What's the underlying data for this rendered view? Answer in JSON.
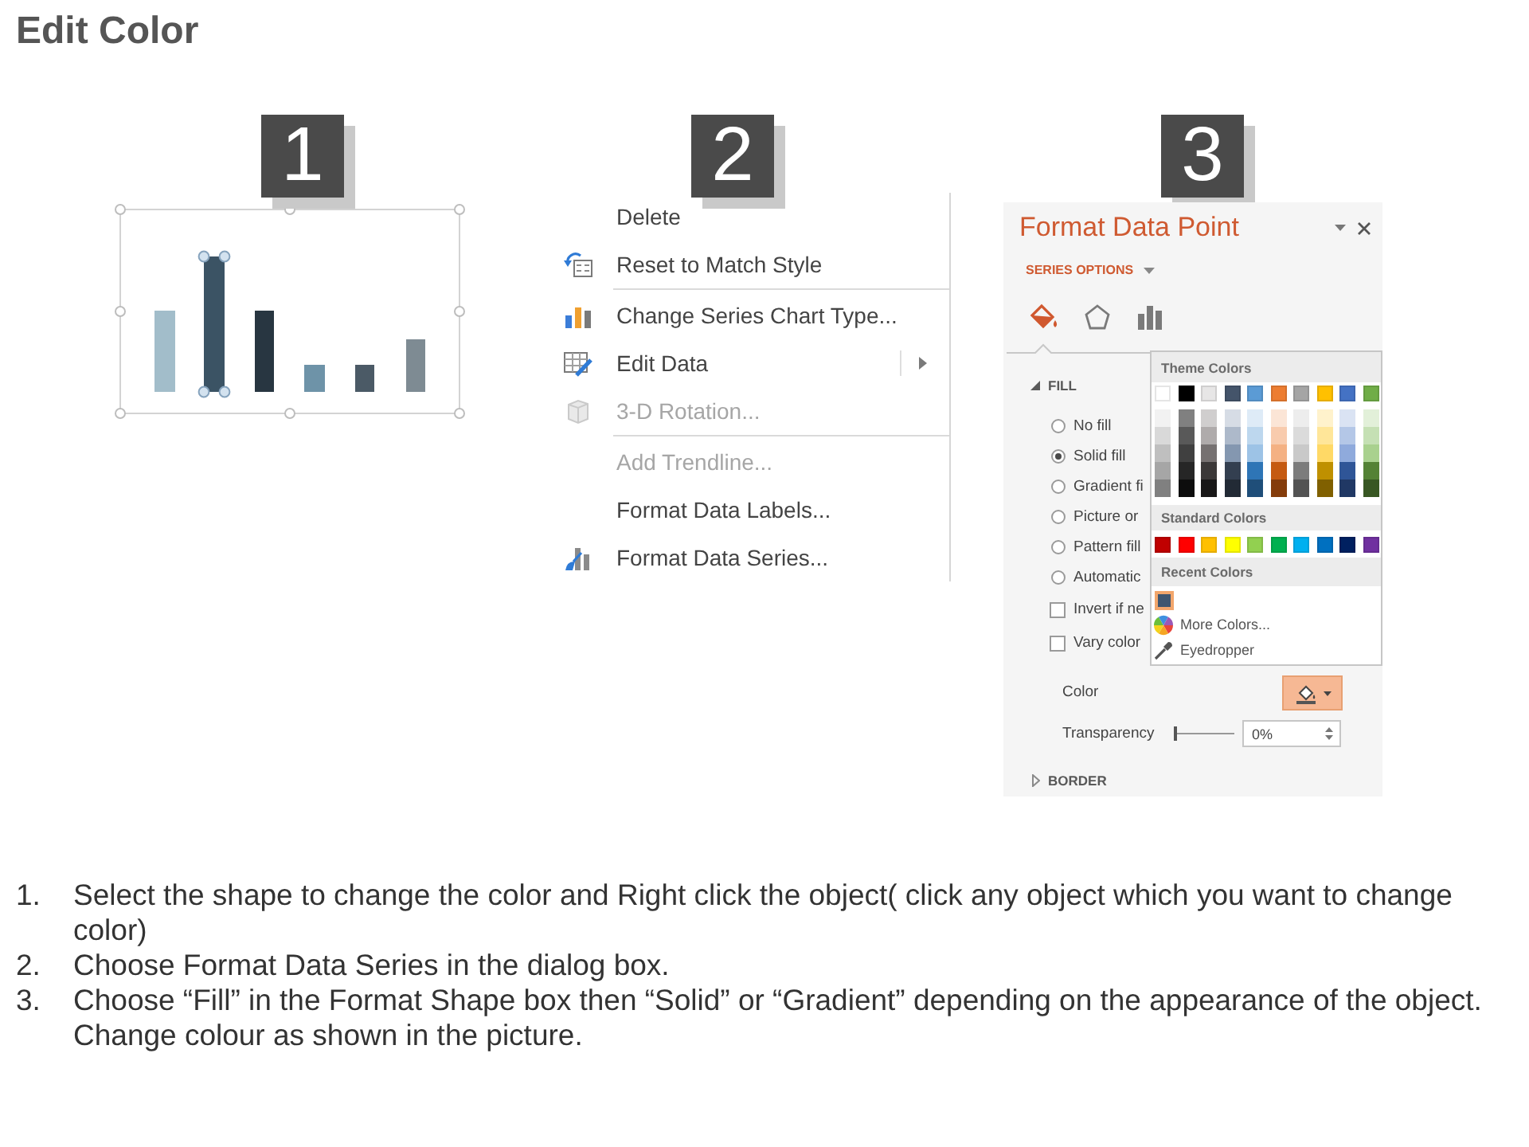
{
  "title": "Edit Color",
  "panels": [
    {
      "kind": "chart",
      "badge": "1",
      "bars": [
        {
          "color": "#a2bdca",
          "selected": false
        },
        {
          "color": "#3b5364",
          "selected": true
        },
        {
          "color": "#283641",
          "selected": false
        },
        {
          "color": "#6e93a8",
          "selected": false
        },
        {
          "color": "#4b5a66",
          "selected": false
        },
        {
          "color": "#7e8b93",
          "selected": false
        }
      ]
    },
    {
      "kind": "menu",
      "badge": "2",
      "items": [
        {
          "kind": "item",
          "label": "Delete",
          "disabled": false,
          "submenu": false
        },
        {
          "kind": "item",
          "label": "Reset to Match Style",
          "disabled": false,
          "submenu": false
        },
        {
          "kind": "separator"
        },
        {
          "kind": "item",
          "label": "Change Series Chart Type...",
          "disabled": false,
          "submenu": false
        },
        {
          "kind": "item",
          "label": "Edit Data",
          "disabled": false,
          "submenu": true
        },
        {
          "kind": "item",
          "label": "3-D Rotation...",
          "disabled": true,
          "submenu": false
        },
        {
          "kind": "separator"
        },
        {
          "kind": "item",
          "label": "Add Trendline...",
          "disabled": true,
          "submenu": false
        },
        {
          "kind": "item",
          "label": "Format Data Labels...",
          "disabled": false,
          "submenu": false
        },
        {
          "kind": "item",
          "label": "Format Data Series...",
          "disabled": false,
          "submenu": false
        }
      ]
    },
    {
      "kind": "pane",
      "badge": "3",
      "title": "Format Data Point",
      "section": "SERIES OPTIONS",
      "tabs": [
        {
          "selected": true
        },
        {
          "selected": false
        },
        {
          "selected": false
        }
      ],
      "fill": {
        "heading": "FILL",
        "expanded": true,
        "options": [
          {
            "label": "No fill",
            "selected": false
          },
          {
            "label": "Solid fill",
            "selected": true
          },
          {
            "label": "Gradient fi",
            "selected": false
          },
          {
            "label": "Picture or",
            "selected": false
          },
          {
            "label": "Pattern fill",
            "selected": false
          },
          {
            "label": "Automatic",
            "selected": false
          }
        ],
        "checkboxes": [
          {
            "label": "Invert if ne",
            "checked": false
          },
          {
            "label": "Vary color",
            "checked": false
          }
        ],
        "color_label": "Color",
        "color_button": {
          "pressed": true
        },
        "transparency": {
          "label": "Transparency",
          "level": 0,
          "value": "0%"
        }
      },
      "border": {
        "heading": "BORDER",
        "expanded": false
      },
      "color_picker": {
        "theme_heading": "Theme Colors",
        "theme_colors": [
          {
            "color": "#ffffff"
          },
          {
            "color": "#000000"
          },
          {
            "color": "#e7e6e6"
          },
          {
            "color": "#44546a"
          },
          {
            "color": "#5b9bd5"
          },
          {
            "color": "#ed7d31"
          },
          {
            "color": "#a5a5a5"
          },
          {
            "color": "#ffc000"
          },
          {
            "color": "#4472c4"
          },
          {
            "color": "#70ad47"
          }
        ],
        "standard_heading": "Standard Colors",
        "standard_colors": [
          {
            "color": "#c00000"
          },
          {
            "color": "#ff0000"
          },
          {
            "color": "#ffc000"
          },
          {
            "color": "#ffff00"
          },
          {
            "color": "#92d050"
          },
          {
            "color": "#00b050"
          },
          {
            "color": "#00b0f0"
          },
          {
            "color": "#0070c0"
          },
          {
            "color": "#002060"
          },
          {
            "color": "#7030a0"
          }
        ],
        "recent_heading": "Recent Colors",
        "recent_colors": [
          {
            "color": "#3f5670",
            "selected": true
          }
        ],
        "more_colors": "More Colors...",
        "eyedropper": "Eyedropper"
      }
    }
  ],
  "instructions": [
    {
      "number": "1.",
      "text": "Select the shape to change the color and Right click the object( click any object which you want to change color)"
    },
    {
      "number": "2.",
      "text": "Choose Format Data Series in the dialog box."
    },
    {
      "number": "3.",
      "text": "Choose “Fill” in the Format Shape box then “Solid” or “Gradient” depending on the appearance of the object. Change colour as shown in the picture."
    }
  ]
}
